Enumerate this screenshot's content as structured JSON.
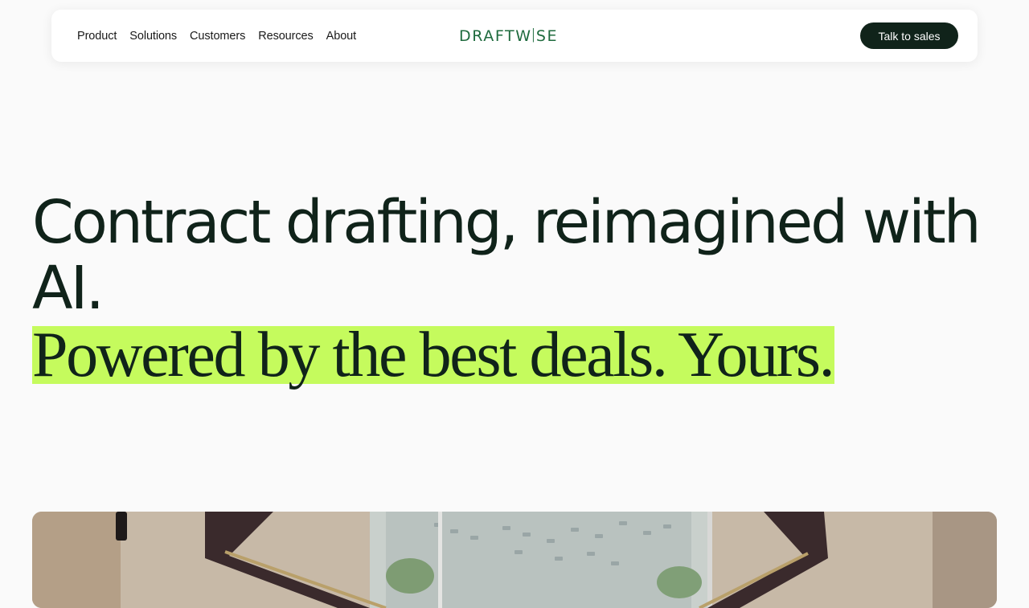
{
  "nav": {
    "links": [
      "Product",
      "Solutions",
      "Customers",
      "Resources",
      "About"
    ],
    "logo": {
      "left": "DRAFTW",
      "bracket": "I",
      "right": "SE"
    },
    "cta_label": "Talk to sales"
  },
  "hero": {
    "title": "Contract drafting, reimagined with AI.",
    "subtitle": "Powered by the best deals. Yours."
  },
  "colors": {
    "accent_highlight": "#c5fb5d",
    "brand_dark": "#10231a",
    "logo_green": "#1f6b3e"
  },
  "media": {
    "hero_image": "office-window-overlooking-parking-lot"
  }
}
